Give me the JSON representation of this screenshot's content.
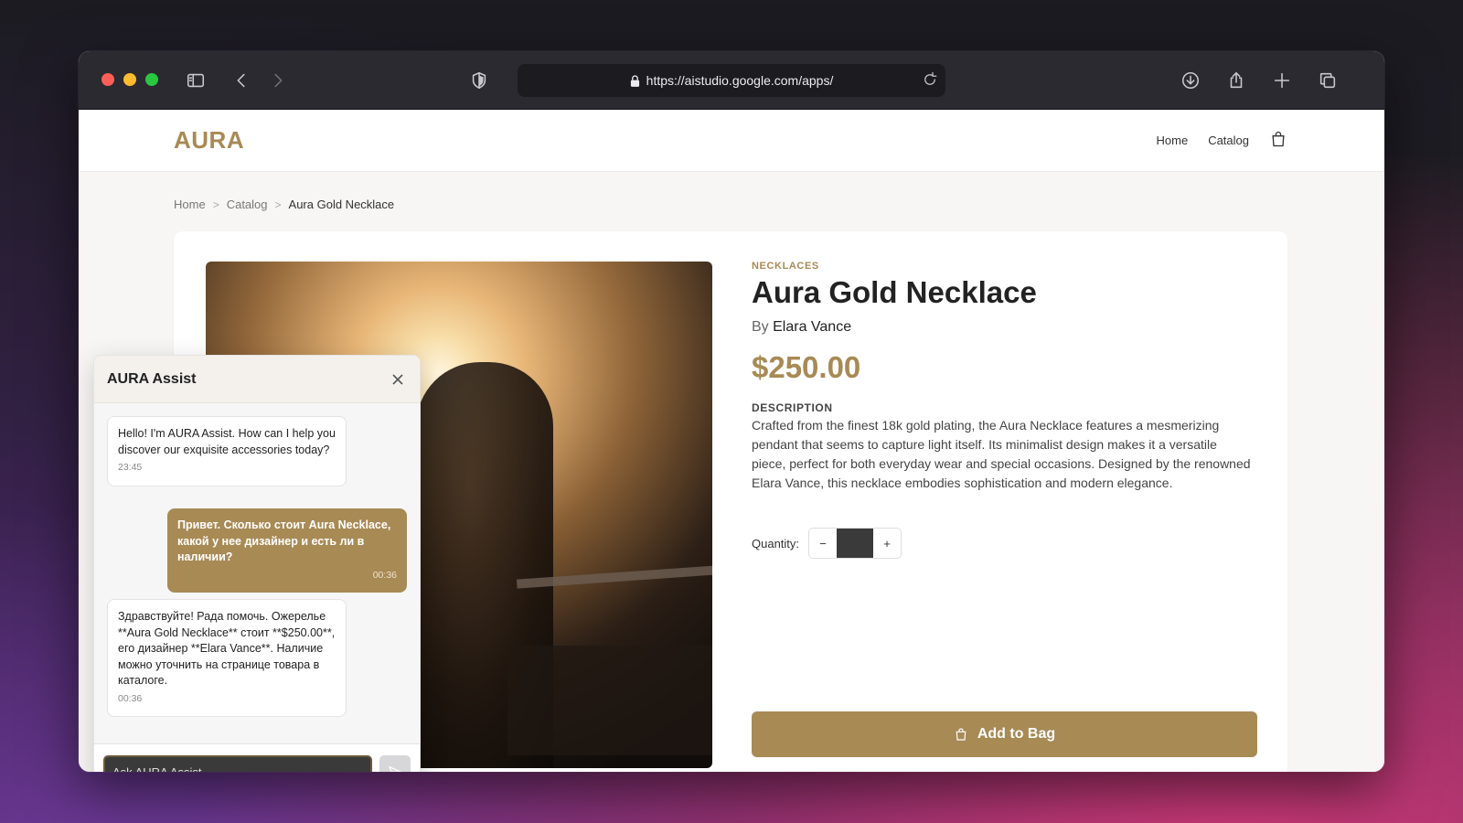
{
  "browser": {
    "url": "https://aistudio.google.com/apps/"
  },
  "site": {
    "logo": "AURA",
    "nav": {
      "home": "Home",
      "catalog": "Catalog"
    }
  },
  "breadcrumb": {
    "home": "Home",
    "catalog": "Catalog",
    "current": "Aura Gold Necklace",
    "separator": ">"
  },
  "product": {
    "category": "NECKLACES",
    "title": "Aura Gold Necklace",
    "by_prefix": "By",
    "designer": "Elara Vance",
    "price": "$250.00",
    "description_label": "DESCRIPTION",
    "description": "Crafted from the finest 18k gold plating, the Aura Necklace features a mesmerizing pendant that seems to capture light itself. Its minimalist design makes it a versatile piece, perfect for both everyday wear and special occasions. Designed by the renowned Elara Vance, this necklace embodies sophistication and modern elegance.",
    "quantity_label": "Quantity:",
    "quantity_minus": "−",
    "quantity_plus": "+",
    "quantity_value": "",
    "add_to_bag": "Add to Bag",
    "accent_color": "#a88a55"
  },
  "chat": {
    "title": "AURA Assist",
    "messages": [
      {
        "role": "bot",
        "text": "Hello! I'm AURA Assist. How can I help you discover our exquisite accessories today?",
        "time": "23:45"
      },
      {
        "role": "user",
        "text": "Привет. Сколько стоит Aura Necklace, какой у нее дизайнер и есть ли в наличии?",
        "time": "00:36"
      },
      {
        "role": "bot",
        "text": "Здравствуйте! Рада помочь. Ожерелье **Aura Gold Necklace** стоит **$250.00**, его дизайнер **Elara Vance**. Наличие можно уточнить на странице товара в каталоге.",
        "time": "00:36"
      }
    ],
    "input_placeholder": "Ask AURA Assist..."
  }
}
